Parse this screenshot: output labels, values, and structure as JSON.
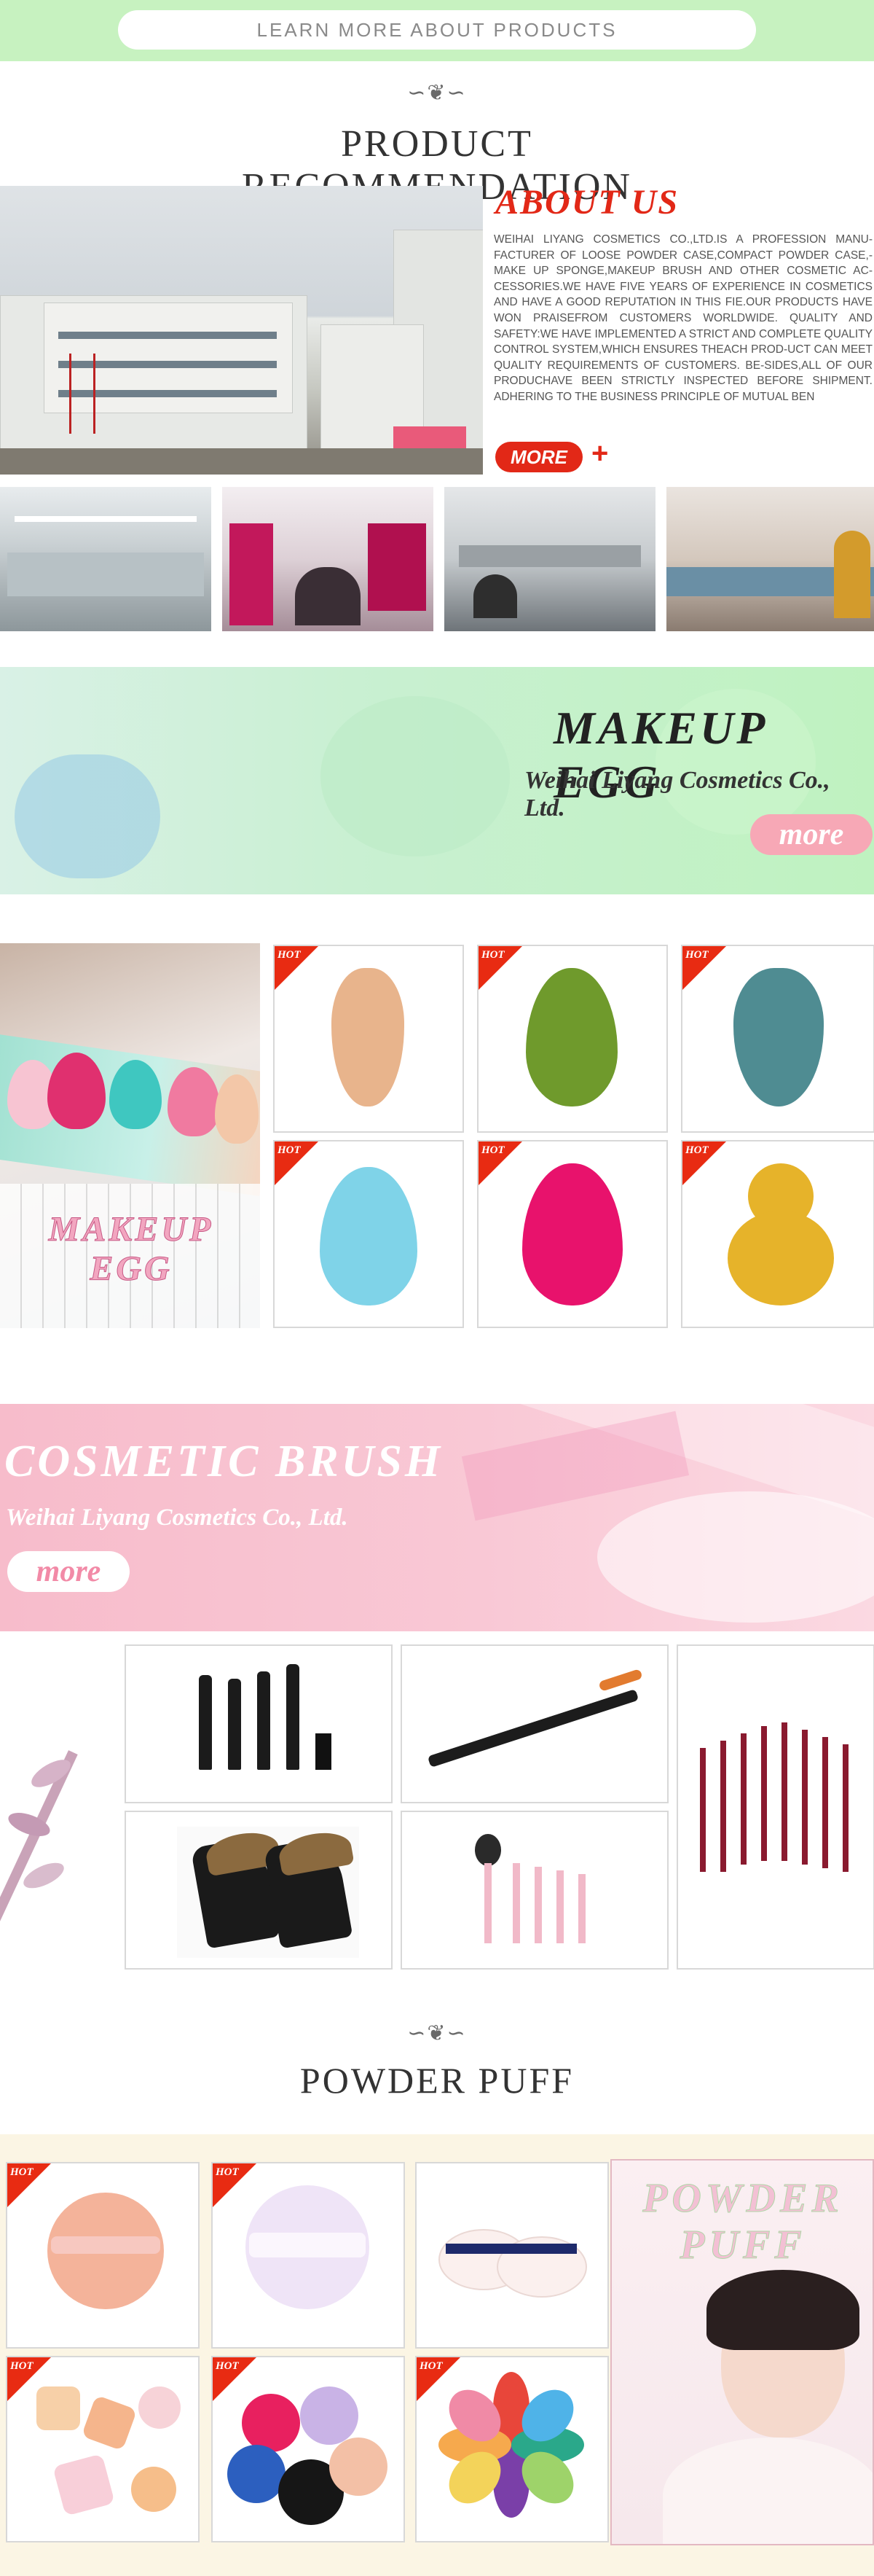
{
  "topbar": {
    "learn_more": "LEARN MORE ABOUT PRODUCTS"
  },
  "recommend": {
    "title": "PRODUCT RECOMMENDATION",
    "ornament": "∽❦∽"
  },
  "about": {
    "title": "ABOUT US",
    "text": "WEIHAI LIYANG COSMETICS CO.,LTD.IS A PROFESSION MANU-FACTURER OF LOOSE POWDER CASE,COMPACT POWDER CASE,-MAKE UP SPONGE,MAKEUP BRUSH AND OTHER COSMETIC AC-CESSORIES.WE HAVE FIVE YEARS OF EXPERIENCE IN COSMETICS AND HAVE A GOOD REPUTATION IN THIS FIE.OUR PRODUCTS HAVE WON PRAISEFROM CUSTOMERS WORLDWIDE. QUALITY AND SAFETY:WE HAVE IMPLEMENTED A STRICT AND COMPLETE QUALITY CONTROL SYSTEM,WHICH ENSURES THEACH PROD-UCT CAN MEET QUALITY REQUIREMENTS OF CUSTOMERS. BE-SIDES,ALL OF OUR PRODUCHAVE BEEN STRICTLY INSPECTED BEFORE SHIPMENT. ADHERING TO THE BUSINESS PRINCIPLE OF MUTUAL BEN",
    "more_label": "MORE",
    "plus": "+"
  },
  "egg": {
    "banner_title": "MAKEUP EGG",
    "banner_sub": "Weihai Liyang Cosmetics Co., Ltd.",
    "more": "more",
    "photo_text": "MAKEUP EGG",
    "hot": "HOT",
    "colors": [
      "#e8b48c",
      "#6f9a2c",
      "#4f8c92",
      "#7fd3e8",
      "#e8126c",
      "#e6b32a"
    ]
  },
  "brush": {
    "banner_title": "COSMETIC BRUSH",
    "banner_sub": "Weihai Liyang Cosmetics Co., Ltd.",
    "more": "more"
  },
  "puff": {
    "title": "POWDER PUFF",
    "ornament": "∽❦∽",
    "photo_text": "POWDER PUFF",
    "hot": "HOT"
  },
  "colors": {
    "accent_red": "#e22817",
    "green_bar": "#c7f2c0",
    "pink": "#f7bccb"
  }
}
